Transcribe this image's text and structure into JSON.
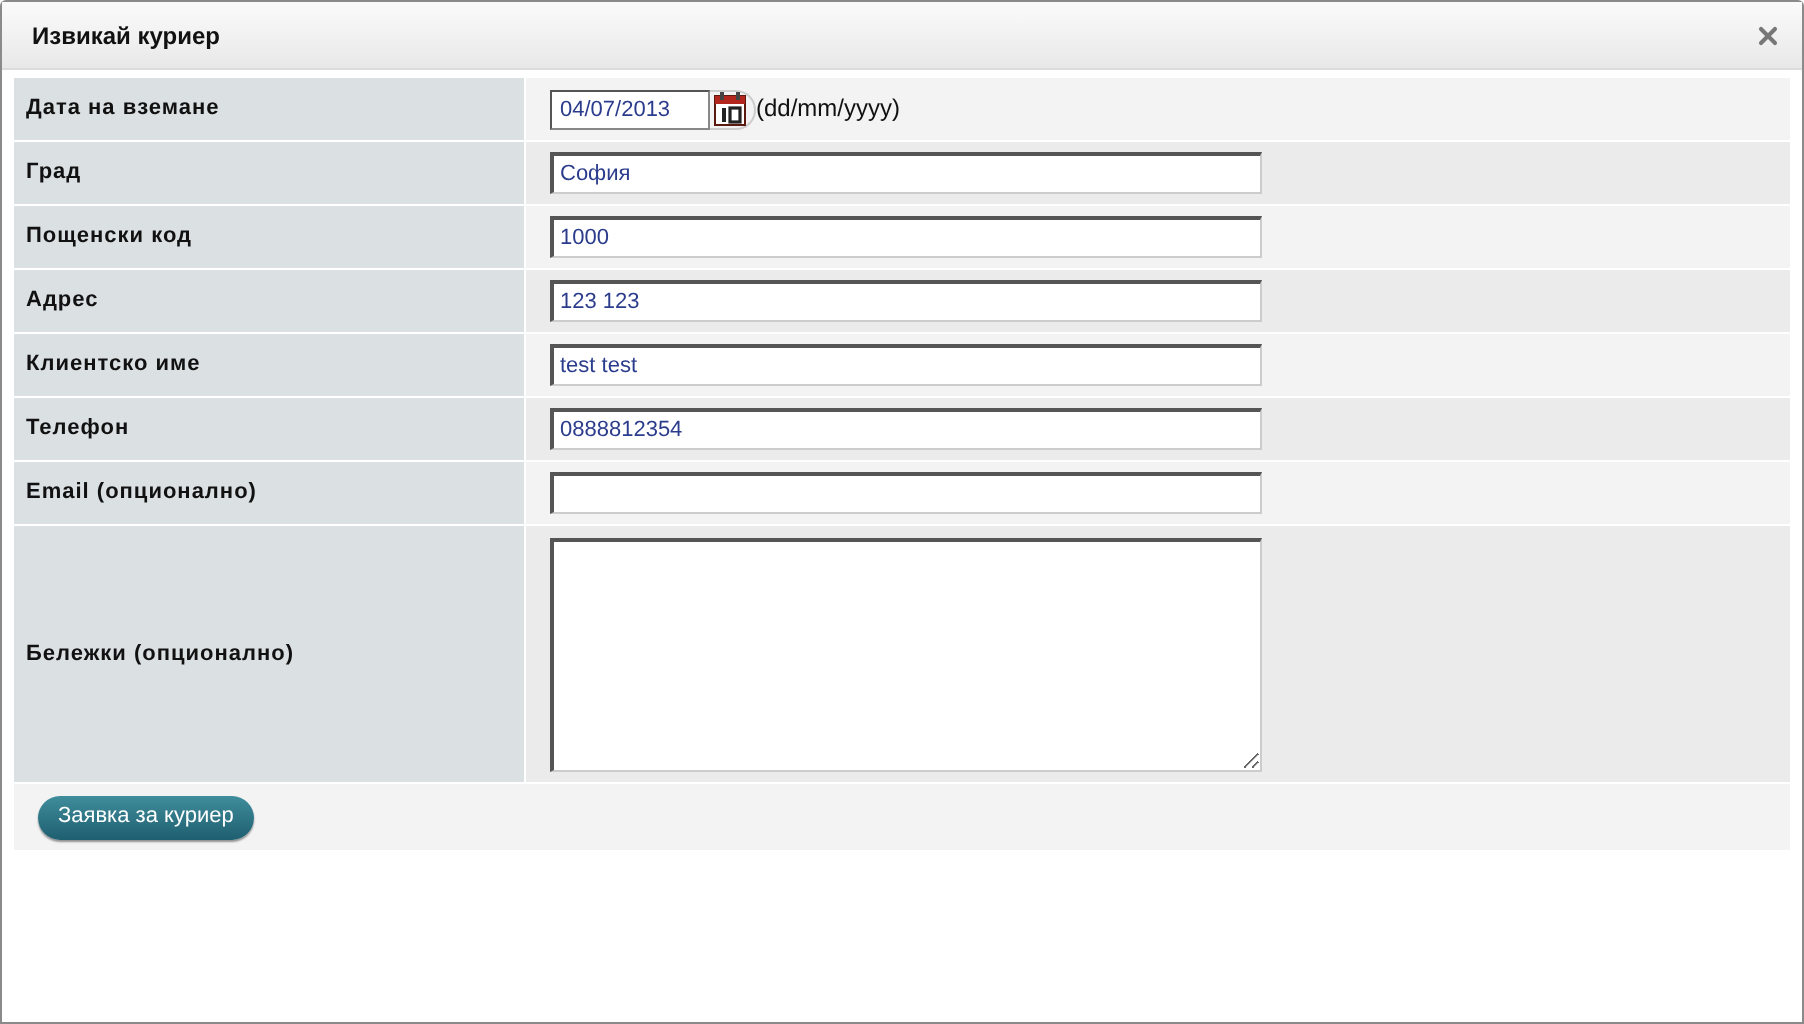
{
  "window": {
    "title": "Извикай куриер"
  },
  "fields": [
    {
      "kind": "date",
      "label": "Дата на вземане",
      "value": "04/07/2013",
      "hint": "(dd/mm/yyyy)"
    },
    {
      "kind": "text",
      "label": "Град",
      "value": "София"
    },
    {
      "kind": "text",
      "label": "Пощенски код",
      "value": "1000"
    },
    {
      "kind": "text",
      "label": "Адрес",
      "value": "123 123"
    },
    {
      "kind": "text",
      "label": "Клиентско име",
      "value": "test test"
    },
    {
      "kind": "text",
      "label": "Телефон",
      "value": "0888812354"
    },
    {
      "kind": "text",
      "label": "Email (опционално)"
    },
    {
      "kind": "textarea",
      "label": "Бележки (опционално)"
    }
  ],
  "submit_button": "Заявка за куриер"
}
